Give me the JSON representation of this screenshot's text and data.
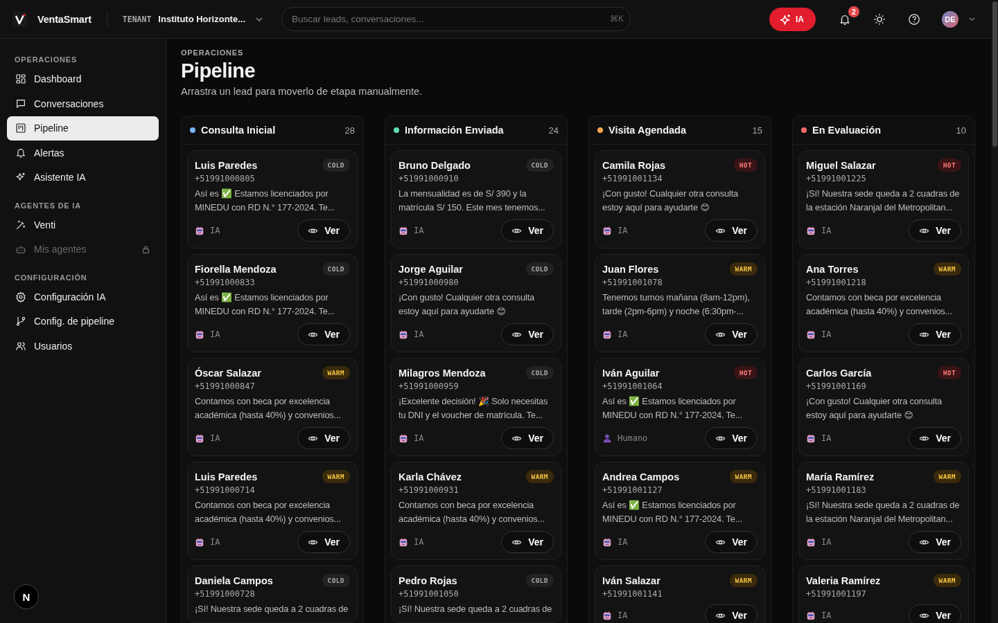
{
  "topbar": {
    "brand": "VentaSmart",
    "tenant_label": "TENANT",
    "tenant_name": "Instituto Horizonte...",
    "search": {
      "placeholder": "Buscar leads, conversaciones..."
    },
    "shortcut": "⌘K",
    "ai_button": "IA",
    "notification_count": "2",
    "avatar": "DE"
  },
  "sidebar": {
    "sections": [
      {
        "title": "OPERACIONES",
        "items": [
          {
            "label": "Dashboard",
            "selected": false,
            "disabled": false
          },
          {
            "label": "Conversaciones",
            "selected": false,
            "disabled": false
          },
          {
            "label": "Pipeline",
            "selected": true,
            "disabled": false
          },
          {
            "label": "Alertas",
            "selected": false,
            "disabled": false
          },
          {
            "label": "Asistente IA",
            "selected": false,
            "disabled": false
          }
        ]
      },
      {
        "title": "AGENTES DE IA",
        "items": [
          {
            "label": "Venti",
            "selected": false,
            "disabled": false
          },
          {
            "label": "Mis agentes",
            "selected": false,
            "disabled": true
          }
        ]
      },
      {
        "title": "CONFIGURACIÓN",
        "items": [
          {
            "label": "Configuración IA",
            "selected": false,
            "disabled": false
          },
          {
            "label": "Config. de pipeline",
            "selected": false,
            "disabled": false
          },
          {
            "label": "Usuarios",
            "selected": false,
            "disabled": false
          }
        ]
      }
    ],
    "dev_badge": "N"
  },
  "page": {
    "eyebrow": "OPERACIONES",
    "title": "Pipeline",
    "subtitle": "Arrastra un lead para moverlo de etapa manualmente."
  },
  "columns": [
    {
      "title": "Consulta Inicial",
      "count": "28",
      "color": "#7ab4ff",
      "cards": [
        {
          "name": "Luis Paredes",
          "phone": "+51991000805",
          "tag": {
            "kind": "cold",
            "text": "COLD"
          },
          "message": "Así es ✅ Estamos licenciados por MINEDU con RD N.° 177-2024. Te...",
          "handler": {
            "kind": "ai",
            "label": "IA"
          },
          "button": "Ver"
        },
        {
          "name": "Fiorella Mendoza",
          "phone": "+51991000833",
          "tag": {
            "kind": "cold",
            "text": "COLD"
          },
          "message": "Así es ✅ Estamos licenciados por MINEDU con RD N.° 177-2024. Te...",
          "handler": {
            "kind": "ai",
            "label": "IA"
          },
          "button": "Ver"
        },
        {
          "name": "Óscar Salazar",
          "phone": "+51991000847",
          "tag": {
            "kind": "warm",
            "text": "WARM"
          },
          "message": "Contamos con beca por excelencia académica (hasta 40%) y convenios...",
          "handler": {
            "kind": "ai",
            "label": "IA"
          },
          "button": "Ver"
        },
        {
          "name": "Luis Paredes",
          "phone": "+51991000714",
          "tag": {
            "kind": "warm",
            "text": "WARM"
          },
          "message": "Contamos con beca por excelencia académica (hasta 40%) y convenios...",
          "handler": {
            "kind": "ai",
            "label": "IA"
          },
          "button": "Ver"
        },
        {
          "name": "Daniela Campos",
          "phone": "+51991000728",
          "tag": {
            "kind": "cold",
            "text": "COLD"
          },
          "message": "¡Sí! Nuestra sede queda a 2 cuadras de"
        }
      ]
    },
    {
      "title": "Información Enviada",
      "count": "24",
      "color": "#5fe0b8",
      "cards": [
        {
          "name": "Bruno Delgado",
          "phone": "+51991000910",
          "tag": {
            "kind": "cold",
            "text": "COLD"
          },
          "message": "La mensualidad es de S/ 390 y la matrícula S/ 150. Este mes tenemos...",
          "handler": {
            "kind": "ai",
            "label": "IA"
          },
          "button": "Ver"
        },
        {
          "name": "Jorge Aguilar",
          "phone": "+51991000980",
          "tag": {
            "kind": "cold",
            "text": "COLD"
          },
          "message": "¡Con gusto! Cualquier otra consulta estoy aquí para ayudarte 😊",
          "handler": {
            "kind": "ai",
            "label": "IA"
          },
          "button": "Ver"
        },
        {
          "name": "Milagros Mendoza",
          "phone": "+51991000959",
          "tag": {
            "kind": "cold",
            "text": "COLD"
          },
          "message": "¡Excelente decisión! 🎉 Solo necesitas tu DNI y el voucher de matrícula. Te...",
          "handler": {
            "kind": "ai",
            "label": "IA"
          },
          "button": "Ver"
        },
        {
          "name": "Karla Chávez",
          "phone": "+51991000931",
          "tag": {
            "kind": "warm",
            "text": "WARM"
          },
          "message": "Contamos con beca por excelencia académica (hasta 40%) y convenios...",
          "handler": {
            "kind": "ai",
            "label": "IA"
          },
          "button": "Ver"
        },
        {
          "name": "Pedro Rojas",
          "phone": "+51991001050",
          "tag": {
            "kind": "cold",
            "text": "COLD"
          },
          "message": "¡Sí! Nuestra sede queda a 2 cuadras de"
        }
      ]
    },
    {
      "title": "Visita Agendada",
      "count": "15",
      "color": "#ffa94d",
      "cards": [
        {
          "name": "Camila Rojas",
          "phone": "+51991001134",
          "tag": {
            "kind": "hot",
            "text": "HOT"
          },
          "message": "¡Con gusto! Cualquier otra consulta estoy aquí para ayudarte 😊",
          "handler": {
            "kind": "ai",
            "label": "IA"
          },
          "button": "Ver"
        },
        {
          "name": "Juan Flores",
          "phone": "+51991001078",
          "tag": {
            "kind": "warm",
            "text": "WARM"
          },
          "message": "Tenemos turnos mañana (8am-12pm), tarde (2pm-6pm) y noche (6:30pm-...",
          "handler": {
            "kind": "ai",
            "label": "IA"
          },
          "button": "Ver"
        },
        {
          "name": "Iván Aguilar",
          "phone": "+51991001064",
          "tag": {
            "kind": "hot",
            "text": "HOT"
          },
          "message": "Así es ✅ Estamos licenciados por MINEDU con RD N.° 177-2024. Te...",
          "handler": {
            "kind": "human",
            "label": "Humano"
          },
          "button": "Ver"
        },
        {
          "name": "Andrea Campos",
          "phone": "+51991001127",
          "tag": {
            "kind": "warm",
            "text": "WARM"
          },
          "message": "Así es ✅ Estamos licenciados por MINEDU con RD N.° 177-2024. Te...",
          "handler": {
            "kind": "ai",
            "label": "IA"
          },
          "button": "Ver"
        },
        {
          "name": "Iván Salazar",
          "phone": "+51991001141",
          "tag": {
            "kind": "warm",
            "text": "WARM"
          },
          "handler": {
            "kind": "ai",
            "label": "IA"
          },
          "button": "Ver"
        }
      ]
    },
    {
      "title": "En Evaluación",
      "count": "10",
      "color": "#ff6b6b",
      "cards": [
        {
          "name": "Miguel Salazar",
          "phone": "+51991001225",
          "tag": {
            "kind": "hot",
            "text": "HOT"
          },
          "message": "¡Sí! Nuestra sede queda a 2 cuadras de la estación Naranjal del Metropolitan...",
          "handler": {
            "kind": "ai",
            "label": "IA"
          },
          "button": "Ver"
        },
        {
          "name": "Ana Torres",
          "phone": "+51991001218",
          "tag": {
            "kind": "warm",
            "text": "WARM"
          },
          "message": "Contamos con beca por excelencia académica (hasta 40%) y convenios...",
          "handler": {
            "kind": "ai",
            "label": "IA"
          },
          "button": "Ver"
        },
        {
          "name": "Carlos García",
          "phone": "+51991001169",
          "tag": {
            "kind": "hot",
            "text": "HOT"
          },
          "message": "¡Con gusto! Cualquier otra consulta estoy aquí para ayudarte 😊",
          "handler": {
            "kind": "ai",
            "label": "IA"
          },
          "button": "Ver"
        },
        {
          "name": "María Ramírez",
          "phone": "+51991001183",
          "tag": {
            "kind": "warm",
            "text": "WARM"
          },
          "message": "¡Sí! Nuestra sede queda a 2 cuadras de la estación Naranjal del Metropolitan...",
          "handler": {
            "kind": "ai",
            "label": "IA"
          },
          "button": "Ver"
        },
        {
          "name": "Valeria Ramírez",
          "phone": "+51991001197",
          "tag": {
            "kind": "warm",
            "text": "WARM"
          },
          "handler": {
            "kind": "ai",
            "label": "IA"
          },
          "button": "Ver"
        }
      ]
    }
  ]
}
